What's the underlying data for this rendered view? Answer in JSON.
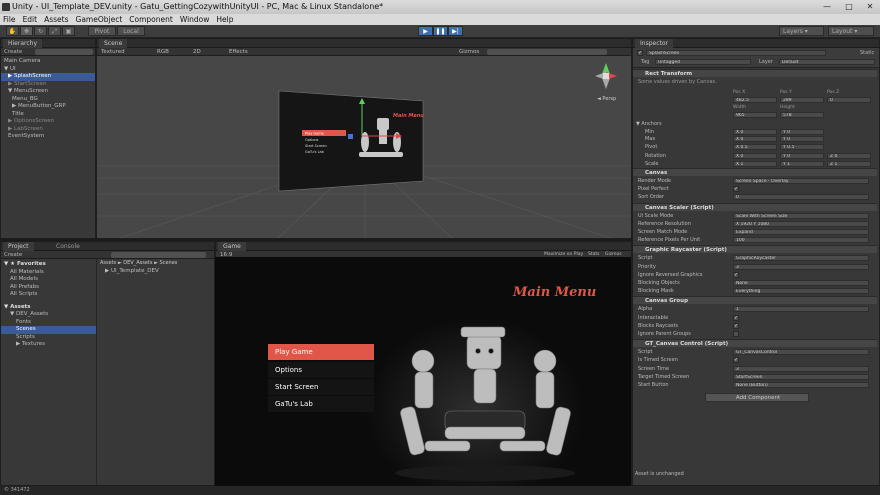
{
  "window": {
    "title": "Unity - UI_Template_DEV.unity - Gatu_GettingCozywithUnityUI - PC, Mac & Linux Standalone*"
  },
  "menu": [
    "File",
    "Edit",
    "Assets",
    "GameObject",
    "Component",
    "Window",
    "Help"
  ],
  "toolbar": {
    "pivot": "Pivot",
    "local": "Local",
    "layers": "Layers",
    "layout": "Layout"
  },
  "hierarchy": {
    "tab": "Hierarchy",
    "create": "Create",
    "items": [
      {
        "label": "Main Camera",
        "indent": 0,
        "selected": false,
        "inactive": false
      },
      {
        "label": "▼ UI",
        "indent": 0,
        "selected": false,
        "inactive": false
      },
      {
        "label": "▶ SplashScreen",
        "indent": 1,
        "selected": true,
        "inactive": false
      },
      {
        "label": "▶ StartScreen",
        "indent": 1,
        "selected": false,
        "inactive": true
      },
      {
        "label": "▼ MenuScreen",
        "indent": 1,
        "selected": false,
        "inactive": false
      },
      {
        "label": "Menu_BG",
        "indent": 2,
        "selected": false,
        "inactive": false
      },
      {
        "label": "▶ MenuButton_GRP",
        "indent": 2,
        "selected": false,
        "inactive": false
      },
      {
        "label": "Title",
        "indent": 2,
        "selected": false,
        "inactive": false
      },
      {
        "label": "▶ OptionsScreen",
        "indent": 1,
        "selected": false,
        "inactive": true
      },
      {
        "label": "▶ LabScreen",
        "indent": 1,
        "selected": false,
        "inactive": true
      },
      {
        "label": "EventSystem",
        "indent": 1,
        "selected": false,
        "inactive": false
      }
    ]
  },
  "scene": {
    "tab": "Scene",
    "shading": "Textured",
    "mode": "RGB",
    "dim": "2D",
    "effects": "Effects",
    "gizmos": "Gizmos",
    "persp": "◄ Persp",
    "title": "Main Menu",
    "buttons": [
      "Play Game",
      "Options",
      "Start Screen",
      "GaTu's Lab"
    ]
  },
  "project": {
    "tabs": [
      "Project",
      "Console"
    ],
    "create": "Create",
    "breadcrumb": "Assets ► DEV_Assets ► Scenes",
    "file": "UI_Template_DEV",
    "tree": [
      {
        "label": "▼ ★ Favorites",
        "indent": 0,
        "bold": true,
        "selected": false
      },
      {
        "label": "All Materials",
        "indent": 1,
        "bold": false,
        "selected": false
      },
      {
        "label": "All Models",
        "indent": 1,
        "bold": false,
        "selected": false
      },
      {
        "label": "All Prefabs",
        "indent": 1,
        "bold": false,
        "selected": false
      },
      {
        "label": "All Scripts",
        "indent": 1,
        "bold": false,
        "selected": false
      },
      {
        "label": "▼ Assets",
        "indent": 0,
        "bold": true,
        "selected": false
      },
      {
        "label": "▼ DEV_Assets",
        "indent": 1,
        "bold": false,
        "selected": false
      },
      {
        "label": "Fonts",
        "indent": 2,
        "bold": false,
        "selected": false
      },
      {
        "label": "Scenes",
        "indent": 2,
        "bold": false,
        "selected": true
      },
      {
        "label": "Scripts",
        "indent": 2,
        "bold": false,
        "selected": false
      },
      {
        "label": "▶ Textures",
        "indent": 2,
        "bold": false,
        "selected": false
      }
    ]
  },
  "game": {
    "tab": "Game",
    "aspect": "16:9",
    "maximize": "Maximize on Play",
    "stats": "Stats",
    "gizmos": "Gizmos",
    "title": "Main Menu",
    "buttons": [
      "Play Game",
      "Options",
      "Start Screen",
      "GaTu's Lab"
    ],
    "highlight": "#e0574a"
  },
  "inspector": {
    "tab": "Inspector",
    "name": "SplashScreen",
    "static": "Static",
    "tag_label": "Tag",
    "tag": "Untagged",
    "layer_label": "Layer",
    "layer": "Default",
    "components": [
      {
        "title": "Rect Transform",
        "fields": []
      },
      {
        "title": "Canvas",
        "fields": [
          {
            "label": "Render Mode",
            "value": "Screen Space - Overlay",
            "check": false
          },
          {
            "label": "Pixel Perfect",
            "value": "",
            "check": true
          },
          {
            "label": "Sort Order",
            "value": "0",
            "check": false
          }
        ]
      },
      {
        "title": "Canvas Scaler (Script)",
        "fields": [
          {
            "label": "Ui Scale Mode",
            "value": "Scale With Screen Size",
            "check": false
          },
          {
            "label": "Reference Resolution",
            "value": "X 1920     Y 1080",
            "check": false
          },
          {
            "label": "Screen Match Mode",
            "value": "Expand",
            "check": false
          },
          {
            "label": "Reference Pixels Per Unit",
            "value": "100",
            "check": false
          }
        ]
      },
      {
        "title": "Graphic Raycaster (Script)",
        "fields": [
          {
            "label": "Script",
            "value": "GraphicRaycaster",
            "check": false
          },
          {
            "label": "Priority",
            "value": "3",
            "check": false
          },
          {
            "label": "Ignore Reversed Graphics",
            "value": "",
            "check": true
          },
          {
            "label": "Blocking Objects",
            "value": "None",
            "check": false
          },
          {
            "label": "Blocking Mask",
            "value": "Everything",
            "check": false
          }
        ]
      },
      {
        "title": "Canvas Group",
        "fields": [
          {
            "label": "Alpha",
            "value": "1",
            "check": false
          },
          {
            "label": "Interactable",
            "value": "",
            "check": true
          },
          {
            "label": "Blocks Raycasts",
            "value": "",
            "check": true
          },
          {
            "label": "Ignore Parent Groups",
            "value": "",
            "check": false
          }
        ]
      },
      {
        "title": "GT_Canvas Control (Script)",
        "fields": [
          {
            "label": "Script",
            "value": "GT_CanvasControl",
            "check": false
          },
          {
            "label": "Is Timed Screen",
            "value": "",
            "check": true
          },
          {
            "label": "Screen Time",
            "value": "3",
            "check": false
          },
          {
            "label": "Target Timed Screen",
            "value": "StartScreen",
            "check": false
          },
          {
            "label": "Start Button",
            "value": "None (Button)",
            "check": false
          }
        ]
      }
    ],
    "rect": {
      "note": "Some values driven by Canvas.",
      "rows": [
        {
          "label": "",
          "cols": [
            "Pos X",
            "Pos Y",
            "Pos Z"
          ]
        },
        {
          "label": "",
          "cols": [
            "482.5",
            "289",
            "0"
          ]
        },
        {
          "label": "",
          "cols": [
            "Width",
            "Height",
            ""
          ]
        },
        {
          "label": "",
          "cols": [
            "965",
            "578",
            ""
          ]
        },
        {
          "label": "▼ Anchors",
          "cols": []
        },
        {
          "label": "Min",
          "cols": [
            "X 0",
            "Y 0",
            ""
          ]
        },
        {
          "label": "Max",
          "cols": [
            "X 0",
            "Y 0",
            ""
          ]
        },
        {
          "label": "Pivot",
          "cols": [
            "X 0.5",
            "Y 0.5",
            ""
          ]
        },
        {
          "label": "Rotation",
          "cols": [
            "X 0",
            "Y 0",
            "Z 0"
          ]
        },
        {
          "label": "Scale",
          "cols": [
            "X 1",
            "Y 1",
            "Z 1"
          ]
        }
      ]
    },
    "add_component": "Add Component",
    "status": "Asset is unchanged"
  },
  "statusbar": {
    "text": "© 341472"
  }
}
